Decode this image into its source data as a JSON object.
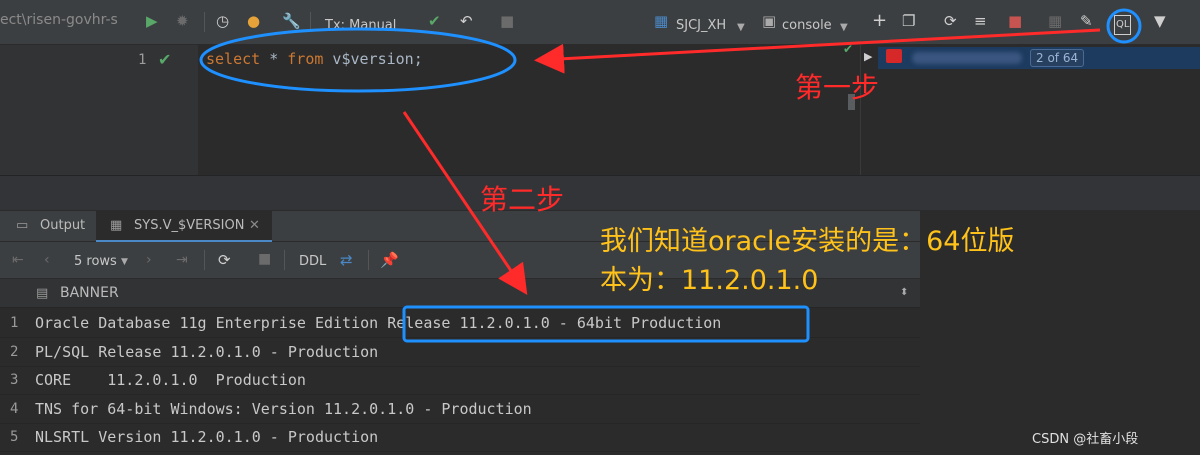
{
  "toolbar": {
    "breadcrumb": "ect\\risen-govhr-s",
    "tx_mode": "Tx: Manual",
    "schema": "SJCJ_XH",
    "console": "console"
  },
  "editor": {
    "line_number": "1",
    "code_keyword_select": "select",
    "code_star": " * ",
    "code_keyword_from": "from",
    "code_rest": " v$version;"
  },
  "session": {
    "counter": "2 of 64"
  },
  "results": {
    "tab_output": "Output",
    "tab_table": "SYS.V_$VERSION",
    "rows_label": "5 rows",
    "ddl_label": "DDL",
    "column_header": "BANNER",
    "rows": [
      {
        "n": "1",
        "v": "Oracle Database 11g Enterprise Edition Release 11.2.0.1.0 - 64bit Production"
      },
      {
        "n": "2",
        "v": "PL/SQL Release 11.2.0.1.0 - Production"
      },
      {
        "n": "3",
        "v": "CORE\t11.2.0.1.0\tProduction"
      },
      {
        "n": "4",
        "v": "TNS for 64-bit Windows: Version 11.2.0.1.0 - Production"
      },
      {
        "n": "5",
        "v": "NLSRTL Version 11.2.0.1.0 - Production"
      }
    ]
  },
  "annotations": {
    "step1": "第一步",
    "step2": "第二步",
    "note_line1": "我们知道oracle安装的是：64位版",
    "note_line2": "本为：11.2.0.1.0"
  },
  "watermark": "CSDN @社畜小段",
  "colors": {
    "annotation_red": "#ff2a2a",
    "annotation_blue": "#1e90ff",
    "annotation_yellow": "#ffc21a"
  }
}
